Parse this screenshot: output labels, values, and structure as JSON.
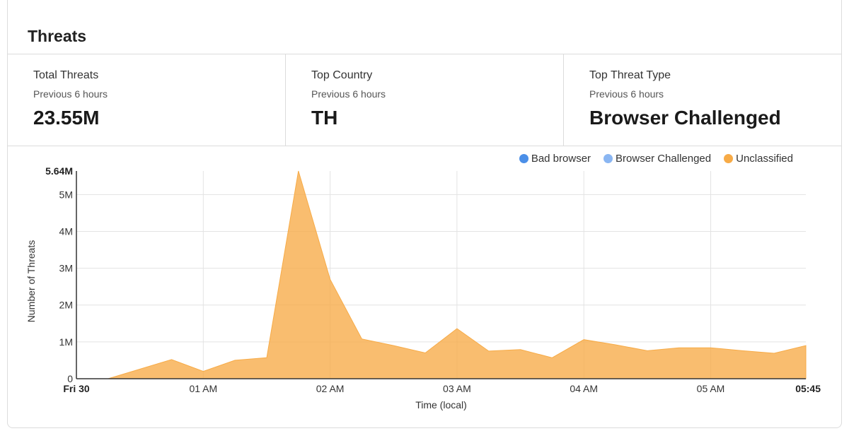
{
  "panel": {
    "title": "Threats"
  },
  "stats": [
    {
      "label": "Total Threats",
      "sub": "Previous 6 hours",
      "value": "23.55M"
    },
    {
      "label": "Top Country",
      "sub": "Previous 6 hours",
      "value": "TH"
    },
    {
      "label": "Top Threat Type",
      "sub": "Previous 6 hours",
      "value": "Browser Challenged"
    }
  ],
  "legend": [
    {
      "label": "Bad browser",
      "color": "#4b8fe8"
    },
    {
      "label": "Browser Challenged",
      "color": "#8ab6f2"
    },
    {
      "label": "Unclassified",
      "color": "#f7ab47"
    }
  ],
  "chart_data": {
    "type": "area",
    "xlabel": "Time (local)",
    "ylabel": "Number of Threats",
    "ylim": [
      0,
      5640000
    ],
    "y_max_label": "5.64M",
    "y_ticks": [
      {
        "value": 0,
        "label": "0"
      },
      {
        "value": 1000000,
        "label": "1M"
      },
      {
        "value": 2000000,
        "label": "2M"
      },
      {
        "value": 3000000,
        "label": "3M"
      },
      {
        "value": 4000000,
        "label": "4M"
      },
      {
        "value": 5000000,
        "label": "5M"
      }
    ],
    "x_ticks": [
      {
        "t": 0,
        "label": "Fri 30",
        "bold": true
      },
      {
        "t": 60,
        "label": "01 AM",
        "bold": false
      },
      {
        "t": 120,
        "label": "02 AM",
        "bold": false
      },
      {
        "t": 180,
        "label": "03 AM",
        "bold": false
      },
      {
        "t": 240,
        "label": "04 AM",
        "bold": false
      },
      {
        "t": 300,
        "label": "05 AM",
        "bold": false
      },
      {
        "t": 345,
        "label": "05:45",
        "bold": true
      }
    ],
    "grid": true,
    "legend_position": "top-right",
    "series": [
      {
        "name": "Unclassified",
        "color": "#f7ab47",
        "x_minutes": [
          0,
          15,
          45,
          60,
          75,
          90,
          105,
          120,
          135,
          150,
          165,
          180,
          195,
          210,
          225,
          240,
          255,
          270,
          285,
          300,
          315,
          330,
          345
        ],
        "values": [
          0,
          0,
          520000,
          200000,
          500000,
          570000,
          5640000,
          2700000,
          1080000,
          900000,
          700000,
          1360000,
          750000,
          790000,
          570000,
          1060000,
          920000,
          760000,
          840000,
          840000,
          760000,
          690000,
          900000
        ]
      }
    ]
  }
}
